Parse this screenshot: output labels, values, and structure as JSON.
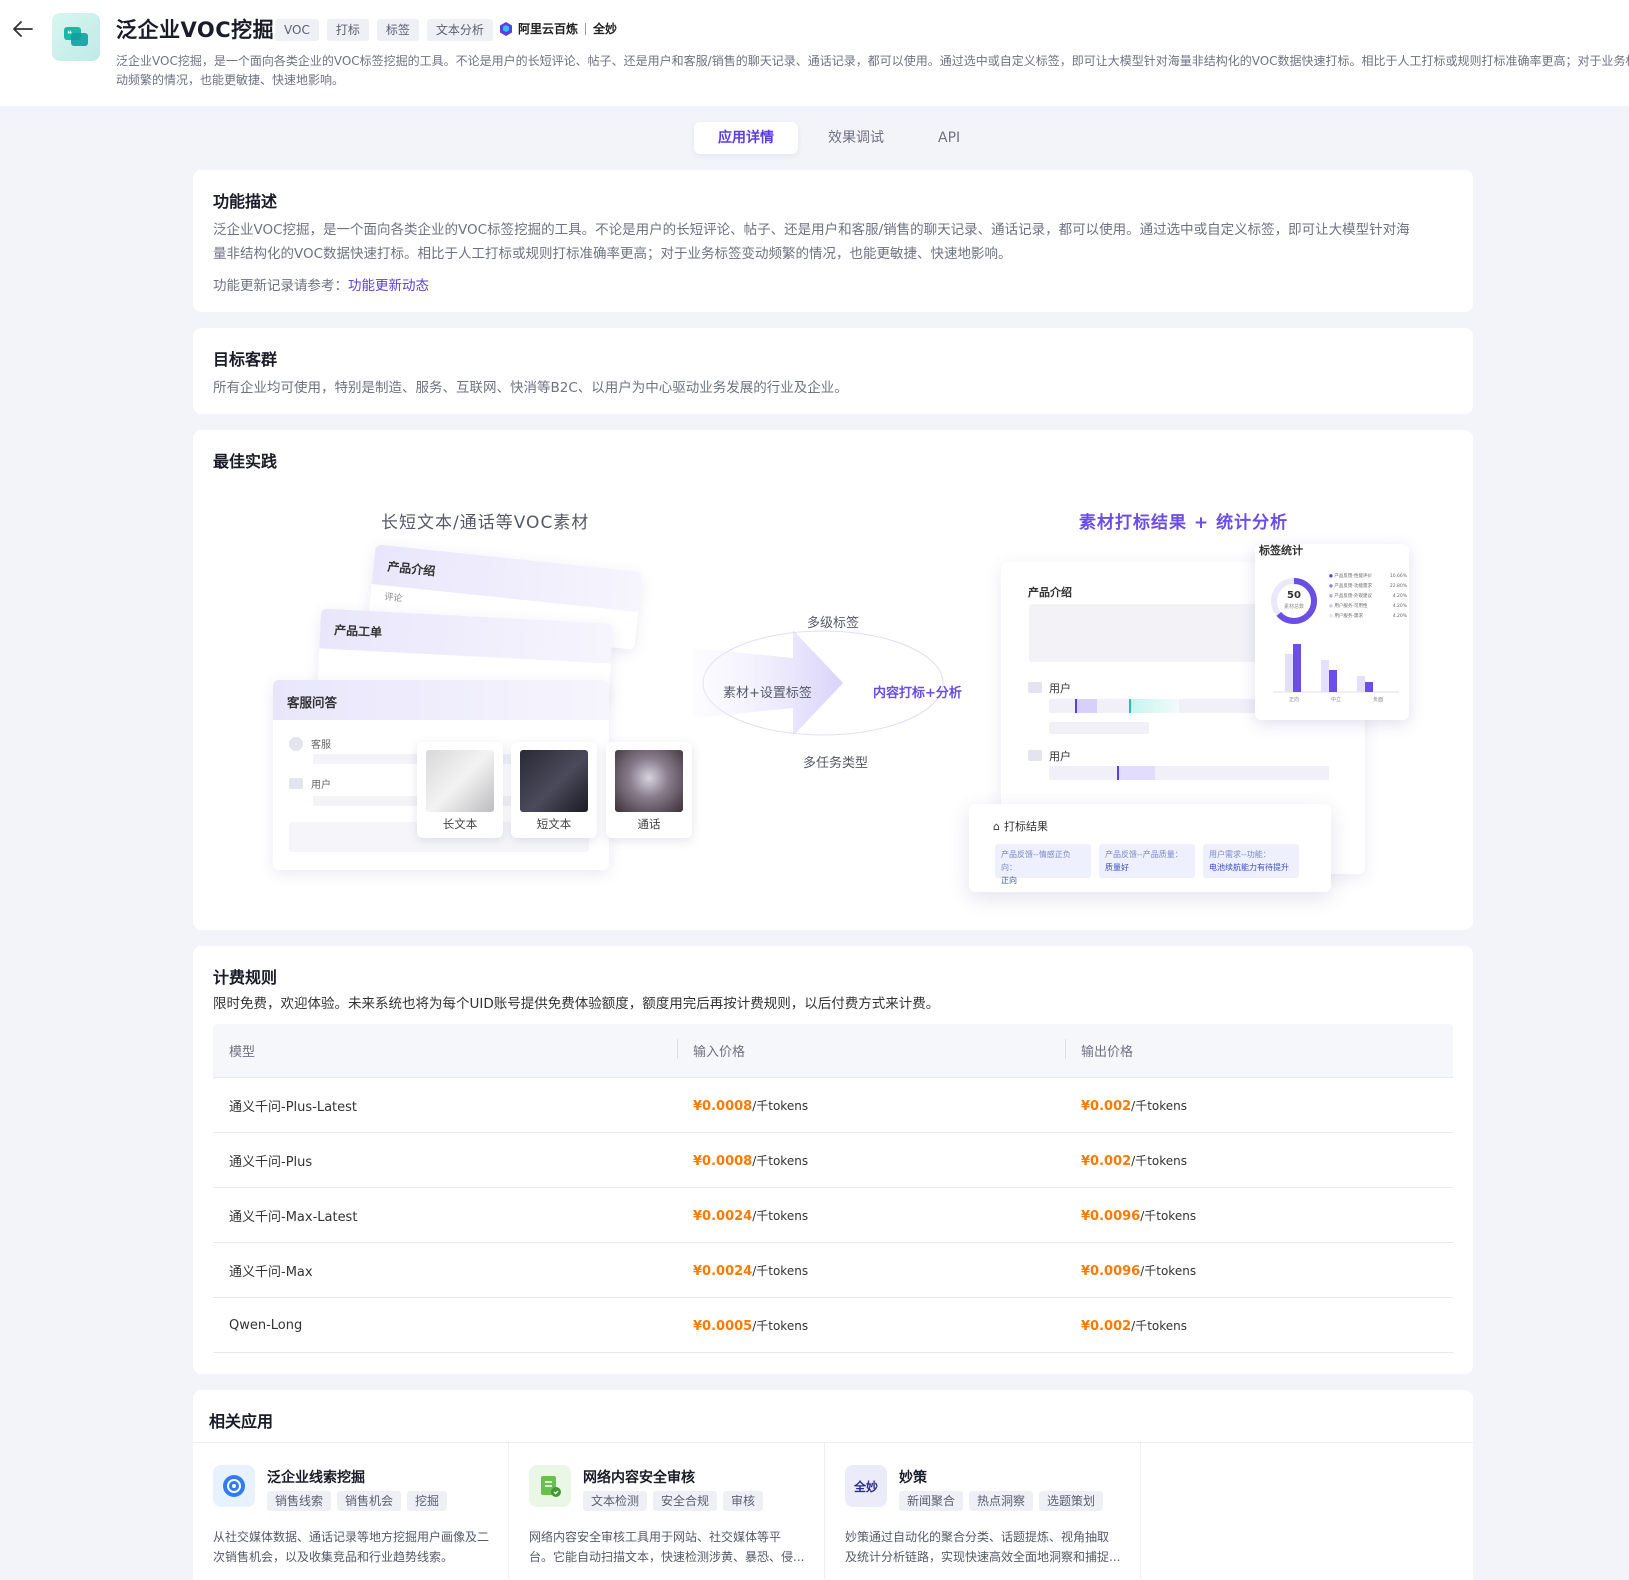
{
  "header": {
    "title": "泛企业VOC挖掘",
    "tags": [
      "VOC",
      "打标",
      "标签",
      "文本分析"
    ],
    "brand_name": "阿里云百炼",
    "brand_partner": "全妙",
    "description_line1": "泛企业VOC挖掘，是一个面向各类企业的VOC标签挖掘的工具。不论是用户的长短评论、帖子、还是用户和客服/销售的聊天记录、通话记录，都可以使用。通过选中或自定义标签，即可让大模型针对海量非结构化的VOC数据快速打标。相比于人工打标或规则打标准确率更高；对于业务标",
    "description_line2": "动频繁的情况，也能更敏捷、快速地影响。"
  },
  "tabs": [
    {
      "label": "应用详情",
      "active": true
    },
    {
      "label": "效果调试",
      "active": false
    },
    {
      "label": "API",
      "active": false
    }
  ],
  "feature": {
    "title": "功能描述",
    "text_line1": "泛企业VOC挖掘，是一个面向各类企业的VOC标签挖掘的工具。不论是用户的长短评论、帖子、还是用户和客服/销售的聊天记录、通话记录，都可以使用。通过选中或自定义标签，即可让大模型针对海",
    "text_line2": "量非结构化的VOC数据快速打标。相比于人工打标或规则打标准确率更高；对于业务标签变动频繁的情况，也能更敏捷、快速地影响。",
    "update_prefix": "功能更新记录请参考：",
    "update_link": "功能更新动态"
  },
  "audience": {
    "title": "目标客群",
    "text": "所有企业均可使用，特别是制造、服务、互联网、快消等B2C、以用户为中心驱动业务发展的行业及企业。"
  },
  "best_practice": {
    "title": "最佳实践",
    "left_title": "长短文本/通话等VOC素材",
    "right_title": "素材打标结果 + 统计分析",
    "doc_cards": [
      "产品介绍",
      "评论",
      "产品工单",
      "客服问答",
      "客服",
      "用户"
    ],
    "media": [
      "长文本",
      "短文本",
      "通话"
    ],
    "flow_top": "多级标签",
    "flow_left": "素材+设置标签",
    "flow_right": "内容打标+分析",
    "flow_bottom": "多任务类型",
    "result": {
      "section": "产品介绍",
      "user1": "用户",
      "user2": "用户",
      "stats_title": "标签统计",
      "donut_value": "50",
      "donut_caption": "素材总数",
      "legend": [
        {
          "label": "产品反馈-性能评价",
          "pct": "10.66%"
        },
        {
          "label": "产品反馈-功能需求",
          "pct": "22.80%"
        },
        {
          "label": "产品反馈-外观建议",
          "pct": "4.20%"
        },
        {
          "label": "用户服务-可用性",
          "pct": "4.20%"
        },
        {
          "label": "用户服务-需求",
          "pct": "4.20%"
        }
      ],
      "bar_labels": [
        "正向",
        "中立",
        "负面"
      ],
      "tag_result_title": "打标结果",
      "result_tags": [
        {
          "k": "产品反馈--情感正负向：",
          "v": "正向"
        },
        {
          "k": "产品反馈--产品质量：",
          "v": "质量好"
        },
        {
          "k": "用户需求--功能：",
          "v": "电池续航能力有待提升"
        }
      ]
    }
  },
  "pricing": {
    "title": "计费规则",
    "note": "限时免费，欢迎体验。未来系统也将为每个UID账号提供免费体验额度，额度用完后再按计费规则，以后付费方式来计费。",
    "columns": [
      "模型",
      "输入价格",
      "输出价格"
    ],
    "unit": "/千tokens",
    "rows": [
      {
        "model": "通义千问-Plus-Latest",
        "input": "¥0.0008",
        "output": "¥0.002"
      },
      {
        "model": "通义千问-Plus",
        "input": "¥0.0008",
        "output": "¥0.002"
      },
      {
        "model": "通义千问-Max-Latest",
        "input": "¥0.0024",
        "output": "¥0.0096"
      },
      {
        "model": "通义千问-Max",
        "input": "¥0.0024",
        "output": "¥0.0096"
      },
      {
        "model": "Qwen-Long",
        "input": "¥0.0005",
        "output": "¥0.002"
      }
    ]
  },
  "related": {
    "title": "相关应用",
    "items": [
      {
        "name": "泛企业线索挖掘",
        "tags": [
          "销售线索",
          "销售机会",
          "挖掘"
        ],
        "desc_line1": "从社交媒体数据、通话记录等地方挖掘用户画像及二",
        "desc_line2": "次销售机会，以及收集竞品和行业趋势线索。",
        "icon": "target-icon",
        "color": "#2f7cf6"
      },
      {
        "name": "网络内容安全审核",
        "tags": [
          "文本检测",
          "安全合规",
          "审核"
        ],
        "desc_line1": "网络内容安全审核工具用于网站、社交媒体等平",
        "desc_line2": "台。它能自动扫描文本，快速检测涉黄、暴恐、侵...",
        "icon": "shield-doc-icon",
        "color": "#4caf50"
      },
      {
        "name": "妙策",
        "tags": [
          "新闻聚合",
          "热点洞察",
          "选题策划"
        ],
        "desc_line1": "妙策通过自动化的聚合分类、话题提炼、视角抽取",
        "desc_line2": "及统计分析链路，实现快速高效全面地洞察和捕捉...",
        "icon": "quanmiao-logo",
        "logo_text": "全妙",
        "color": "#3b3bb5"
      }
    ]
  }
}
